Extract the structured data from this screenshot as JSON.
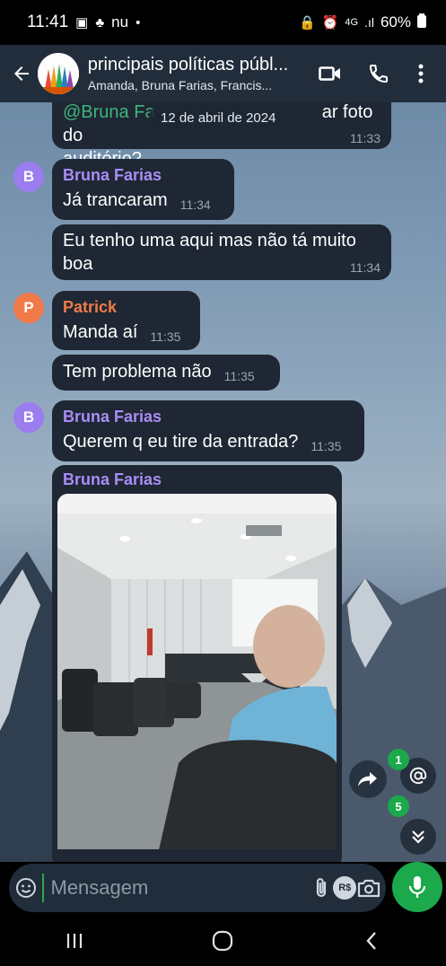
{
  "status_bar": {
    "time": "11:41",
    "carrier": "nu",
    "network": "4G",
    "battery": "60%"
  },
  "header": {
    "title": "principais políticas públ...",
    "subtitle": "Amanda, Bruna Farias, Francis..."
  },
  "chat": {
    "date_pill": "12 de abril de 2024",
    "reply_fragment": {
      "mention": "@Bruna Fa",
      "text_tail": "ar foto do",
      "text_line2": "auditório?",
      "time": "11:33"
    },
    "messages": [
      {
        "sender": "Bruna Farias",
        "initial": "B",
        "text": "Já trancaram",
        "time": "11:34"
      },
      {
        "sender": "",
        "text": "Eu tenho uma aqui mas não tá muito boa",
        "time": "11:34"
      },
      {
        "sender": "Patrick",
        "initial": "P",
        "text": "Manda aí",
        "time": "11:35"
      },
      {
        "sender": "",
        "text": "Tem problema não",
        "time": "11:35"
      },
      {
        "sender": "Bruna Farias",
        "initial": "B",
        "text": "Querem q eu tire da entrada?",
        "time": "11:35"
      },
      {
        "sender": "Bruna Farias",
        "text": "",
        "time": ""
      }
    ]
  },
  "badges": {
    "mentions_count": "1",
    "unread_count": "5"
  },
  "composer": {
    "placeholder": "Mensagem",
    "currency_label": "R$"
  },
  "colors": {
    "header_bg": "#212d3b",
    "bubble_bg": "#1e2733",
    "accent_green": "#1ba94c",
    "sender_purple": "#a98df6",
    "sender_orange": "#f07a49",
    "mention_green": "#3fb57c"
  },
  "icons": {
    "back": "arrow-left-icon",
    "video": "video-camera-icon",
    "call": "phone-icon",
    "menu": "more-vertical-icon",
    "share": "share-forward-icon",
    "mention": "at-sign-icon",
    "scroll_down": "chevron-double-down-icon",
    "emoji": "emoji-icon",
    "attach": "paperclip-icon",
    "camera": "camera-icon",
    "mic": "microphone-icon"
  }
}
